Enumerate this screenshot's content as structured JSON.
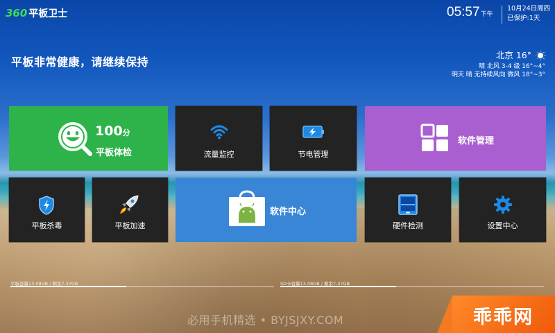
{
  "header": {
    "logo_num": "360",
    "logo_text": "平板卫士",
    "time": "05:57",
    "ampm": "下午",
    "date": "10月24日周四",
    "protected": "已保护:1天"
  },
  "status": {
    "health": "平板非常健康，请继续保持"
  },
  "weather": {
    "city_temp": "北京 16°",
    "today": "晴 北风 3-4 级 16°~4°",
    "tomorrow": "明天 晴 无持续风向 微风 18°~3°"
  },
  "tiles": {
    "check": {
      "score": "100",
      "unit": "分",
      "label": "平板体检"
    },
    "flow": {
      "label": "流量监控"
    },
    "power": {
      "label": "节电管理"
    },
    "software": {
      "label": "软件管理"
    },
    "virus": {
      "label": "平板杀毒"
    },
    "speed": {
      "label": "平板加速"
    },
    "center": {
      "label": "软件中心"
    },
    "hardware": {
      "label": "硬件检测"
    },
    "settings": {
      "label": "设置中心"
    }
  },
  "storage": {
    "tablet": "平板容量13.08GB / 剩余7.37GB",
    "sd": "SD卡容量13.08GB / 剩余7.37GB",
    "tablet_used_fraction": 0.44,
    "sd_used_fraction": 0.44
  },
  "watermark": "必用手机精选 • BYJSJXY.COM",
  "corner_badge": "乖乖网",
  "colors": {
    "green_tile": "#2db34a",
    "purple_tile": "#a95fcf",
    "blue_tile": "#3a86d6",
    "dark_tile": "#232323",
    "icon_blue": "#1e88e5",
    "logo_green": "#3ddc5a",
    "badge_orange": "#f05a0a"
  },
  "icons": {
    "check": "smiley-magnifier-icon",
    "flow": "wifi-icon",
    "power": "battery-icon",
    "software": "grid-apps-icon",
    "virus": "shield-bolt-icon",
    "speed": "rocket-icon",
    "center": "shopping-bag-android-icon",
    "hardware": "tablet-icon",
    "settings": "gear-icon"
  }
}
